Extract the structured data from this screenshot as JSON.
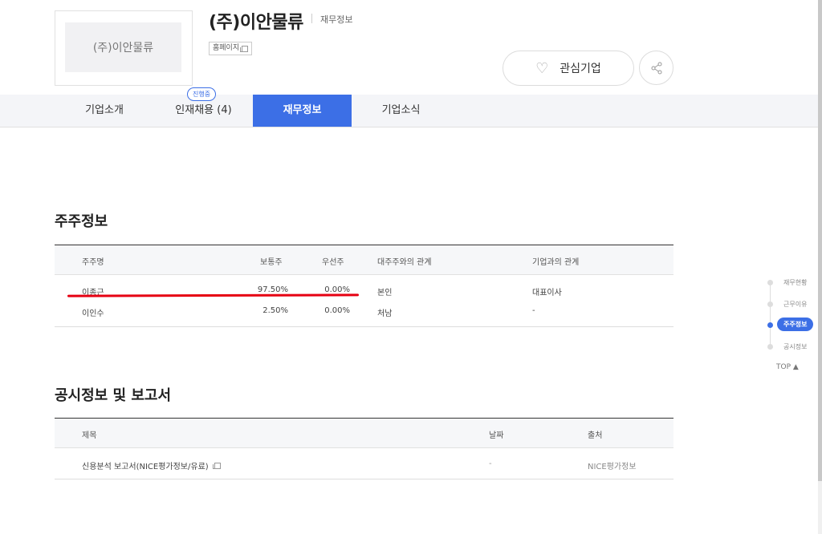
{
  "company": {
    "logo_text": "(주)이안물류",
    "name": "(주)이안물류",
    "page_label": "재무정보",
    "homepage_label": "홈페이지",
    "favorite_label": "관심기업"
  },
  "tabs": [
    {
      "label": "기업소개"
    },
    {
      "label": "인재채용 (4)",
      "badge": "진행중"
    },
    {
      "label": "재무정보"
    },
    {
      "label": "기업소식"
    }
  ],
  "shareholders": {
    "title": "주주정보",
    "columns": [
      "주주명",
      "보통주",
      "우선주",
      "대주주와의 관계",
      "기업과의 관계"
    ],
    "rows": [
      [
        "이종근",
        "97.50%",
        "0.00%",
        "본인",
        "대표이사"
      ],
      [
        "이인수",
        "2.50%",
        "0.00%",
        "처남",
        "-"
      ]
    ]
  },
  "disclosures": {
    "title": "공시정보 및 보고서",
    "columns": [
      "제목",
      "날짜",
      "출처"
    ],
    "rows": [
      [
        "신용분석 보고서(NICE평가정보/유료)",
        "-",
        "NICE평가정보"
      ]
    ]
  },
  "side_nav": {
    "items": [
      "재무현황",
      "근무이유",
      "주주정보",
      "공시정보"
    ],
    "active_index": 2,
    "top_label": "TOP ▲"
  },
  "colors": {
    "accent": "#3c6fe6",
    "highlight_underline": "#e60012"
  }
}
